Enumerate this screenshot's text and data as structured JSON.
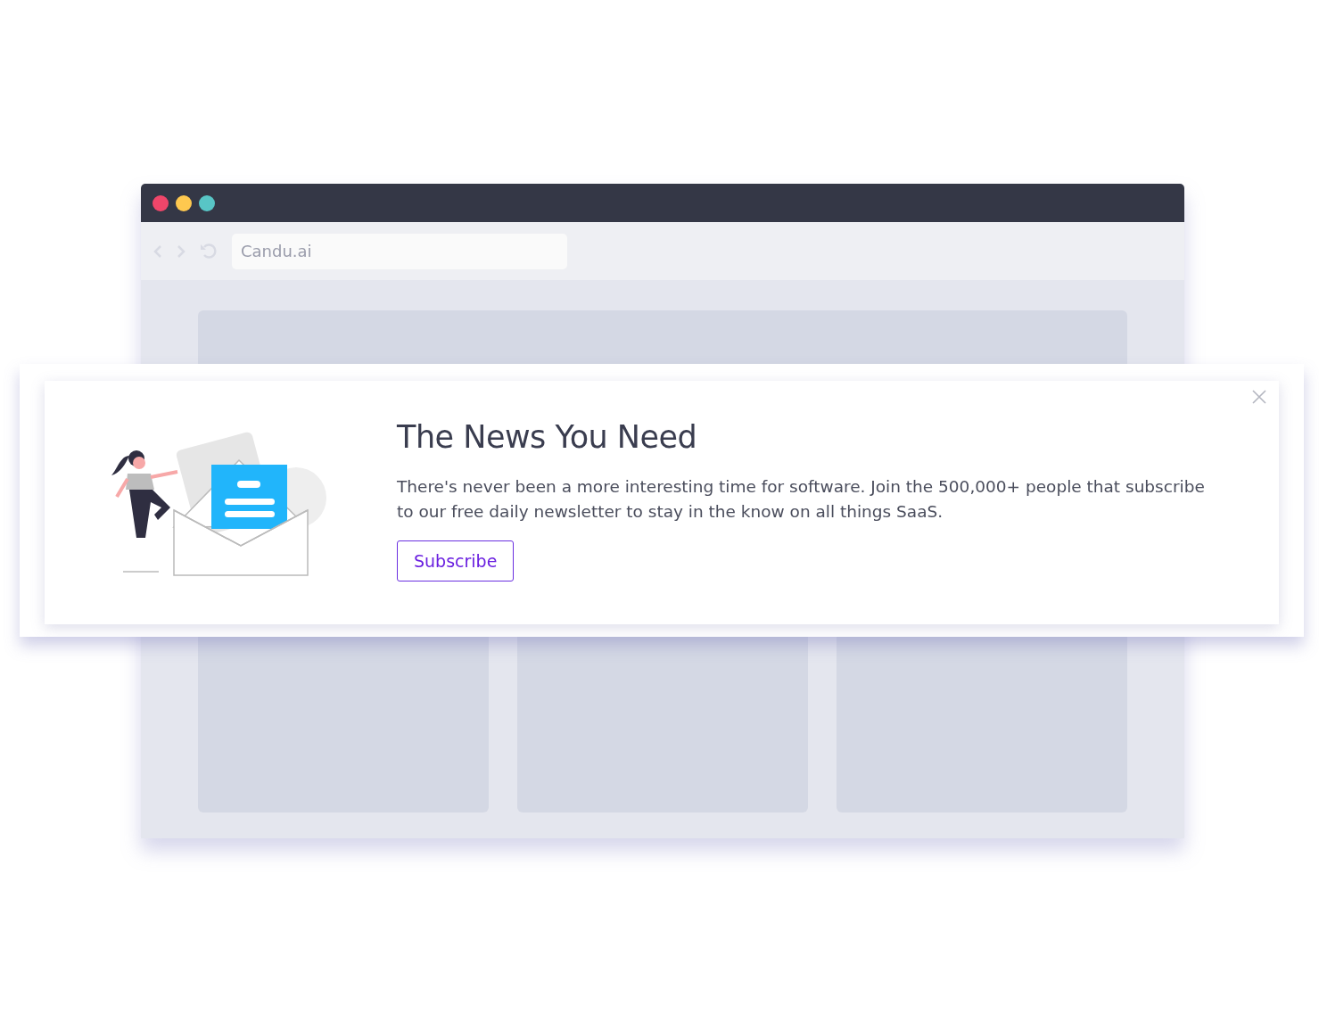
{
  "browser": {
    "traffic_lights": [
      {
        "color": "#f0466a"
      },
      {
        "color": "#fec84f"
      },
      {
        "color": "#58c5c6"
      }
    ],
    "address": "Candu.ai"
  },
  "banner": {
    "title": "The News You Need",
    "body": "There's never been a more interesting time for software. Join the 500,000+ people that subscribe to our free daily newsletter to stay in the know on all things SaaS.",
    "button": "Subscribe"
  }
}
